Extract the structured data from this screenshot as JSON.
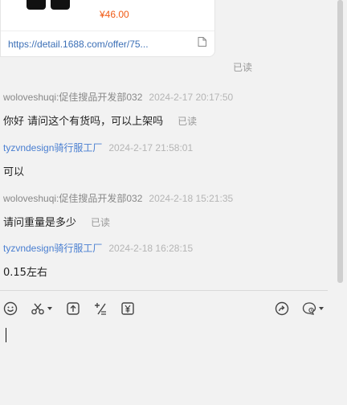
{
  "product_card": {
    "price": "¥46.00",
    "link": "https://detail.1688.com/offer/75..."
  },
  "card_read_status": "已读",
  "messages": [
    {
      "sender": "woloveshuqi:促佳搜品开发部032",
      "time": "2024-2-17 20:17:50",
      "text": "你好 请问这个有货吗，可以上架吗",
      "read": "已读"
    },
    {
      "sender": "tyzvndesign骑行服工厂",
      "time": "2024-2-17 21:58:01",
      "text": "可以"
    },
    {
      "sender": "woloveshuqi:促佳搜品开发部032",
      "time": "2024-2-18 15:21:35",
      "text": "请问重量是多少",
      "read": "已读"
    },
    {
      "sender": "tyzvndesign骑行服工厂",
      "time": "2024-2-18 16:28:15",
      "text": "0.15左右"
    }
  ],
  "toolbar": {
    "icons": [
      "emoji-icon",
      "scissors-icon",
      "upload-icon",
      "format-icon",
      "yen-icon",
      "forward-icon",
      "quick-reply-icon"
    ]
  },
  "colors": {
    "price": "#f05a14",
    "link": "#3b6fb6",
    "self_name": "#4a7fd1",
    "other_name": "#888888"
  }
}
